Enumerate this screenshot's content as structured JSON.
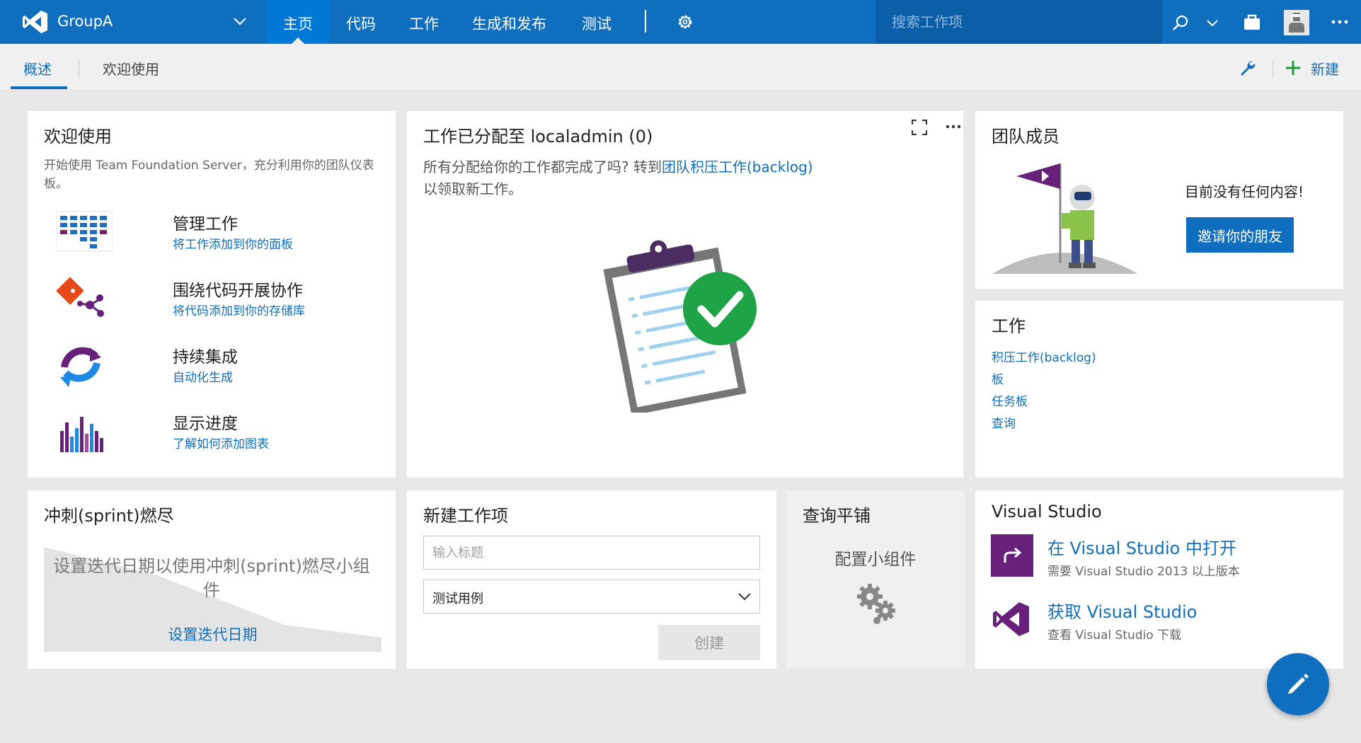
{
  "header": {
    "project": "GroupA",
    "nav": [
      "主页",
      "代码",
      "工作",
      "生成和发布",
      "测试"
    ],
    "search_placeholder": "搜索工作项"
  },
  "subnav": {
    "tabs": [
      "概述",
      "欢迎使用"
    ],
    "new_label": "新建"
  },
  "welcome": {
    "title": "欢迎使用",
    "desc": "开始使用 Team Foundation Server，充分利用你的团队仪表板。",
    "items": [
      {
        "title": "管理工作",
        "sub": "将工作添加到你的面板",
        "icon": "board-icon"
      },
      {
        "title": "围绕代码开展协作",
        "sub": "将代码添加到你的存储库",
        "icon": "git-icon"
      },
      {
        "title": "持续集成",
        "sub": "自动化生成",
        "icon": "sync-icon"
      },
      {
        "title": "显示进度",
        "sub": "了解如何添加图表",
        "icon": "bar-chart-icon"
      }
    ]
  },
  "assigned": {
    "title": "工作已分配至 localadmin (0)",
    "desc_before": "所有分配给你的工作都完成了吗? 转到",
    "desc_link": "团队积压工作(backlog)",
    "desc_after": "以领取新工作。"
  },
  "team": {
    "title": "团队成员",
    "empty": "目前没有任何内容!",
    "invite": "邀请你的朋友"
  },
  "work": {
    "title": "工作",
    "links": [
      "积压工作(backlog)",
      "板",
      "任务板",
      "查询"
    ]
  },
  "burndown": {
    "title": "冲刺(sprint)燃尽",
    "message": "设置迭代日期以使用冲刺(sprint)燃尽小组件",
    "link": "设置迭代日期"
  },
  "new_work_item": {
    "title": "新建工作项",
    "placeholder": "输入标题",
    "type_value": "测试用例",
    "create": "创建"
  },
  "query_tile": {
    "title": "查询平铺",
    "config": "配置小组件"
  },
  "visual_studio": {
    "title": "Visual Studio",
    "items": [
      {
        "title": "在 Visual Studio 中打开",
        "sub": "需要 Visual Studio 2013 以上版本"
      },
      {
        "title": "获取 Visual Studio",
        "sub": "查看 Visual Studio 下载"
      }
    ]
  },
  "colors": {
    "brand_blue": "#106ebe",
    "vs_purple": "#68217a",
    "success_green": "#1ea446"
  }
}
